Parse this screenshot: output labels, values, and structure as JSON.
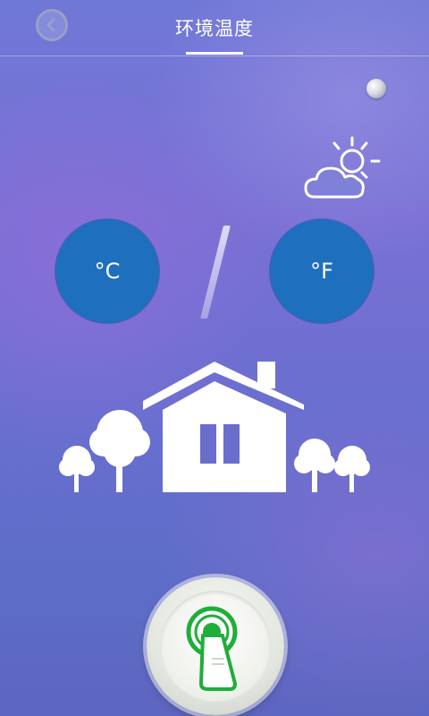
{
  "header": {
    "title": "环境温度",
    "back_icon": "chevron-left-icon"
  },
  "status": {
    "indicator_icon": "status-dot-icon"
  },
  "weather": {
    "icon": "partly-cloudy-icon"
  },
  "units": {
    "celsius_label": "°C",
    "fahrenheit_label": "°F",
    "accent": "#1f6fbf"
  },
  "scene": {
    "icon": "house-with-trees-icon"
  },
  "action": {
    "icon": "finger-touch-icon",
    "ring_color": "#1fae3a"
  }
}
